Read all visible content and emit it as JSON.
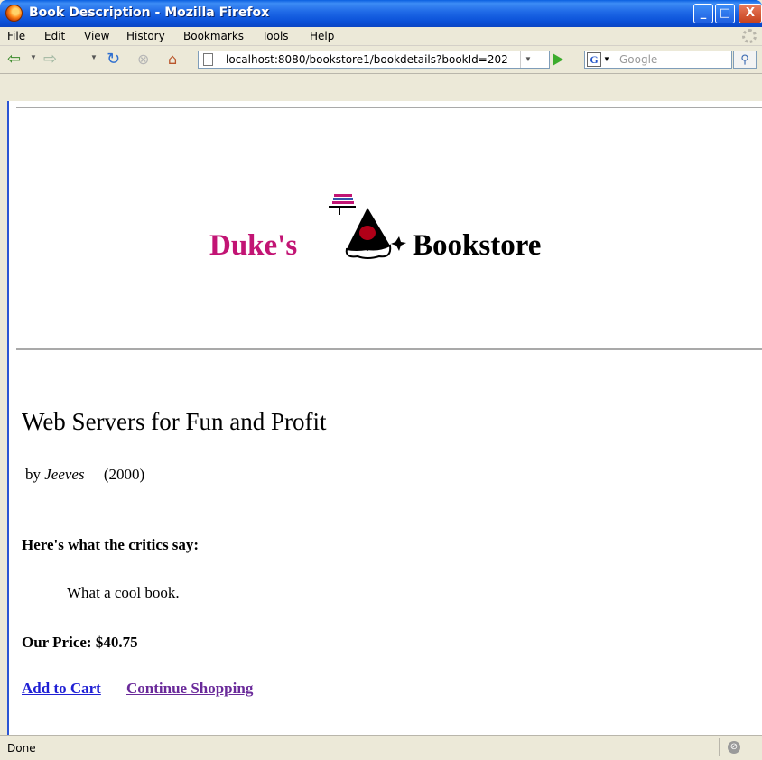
{
  "window": {
    "title": "Book Description - Mozilla Firefox",
    "controls": {
      "minimize": "_",
      "maximize": "□",
      "close": "X"
    }
  },
  "menu": [
    "File",
    "Edit",
    "View",
    "History",
    "Bookmarks",
    "Tools",
    "Help"
  ],
  "navbar": {
    "url": "localhost:8080/bookstore1/bookdetails?bookId=202",
    "search_placeholder": "Google",
    "icons": [
      "back-icon",
      "forward-icon",
      "reload-icon",
      "stop-icon",
      "home-icon",
      "go-icon",
      "google-icon",
      "search-icon"
    ]
  },
  "page": {
    "logo_left": "Duke's",
    "logo_right": "Bookstore",
    "book_title": "Web Servers for Fun and Profit",
    "by": "by",
    "author": "Jeeves",
    "year": "(2000)",
    "critics_heading": "Here's what the critics say:",
    "review": "What a cool book.",
    "price": "Our Price: $40.75",
    "add_to_cart": "Add to Cart",
    "continue_shopping": "Continue Shopping"
  },
  "status": {
    "text": "Done"
  },
  "colors": {
    "duke_magenta": "#c21474",
    "link_blue": "#1f1fd4",
    "visited_purple": "#6a2a9a",
    "xp_title_blue": "#0a50d8"
  }
}
